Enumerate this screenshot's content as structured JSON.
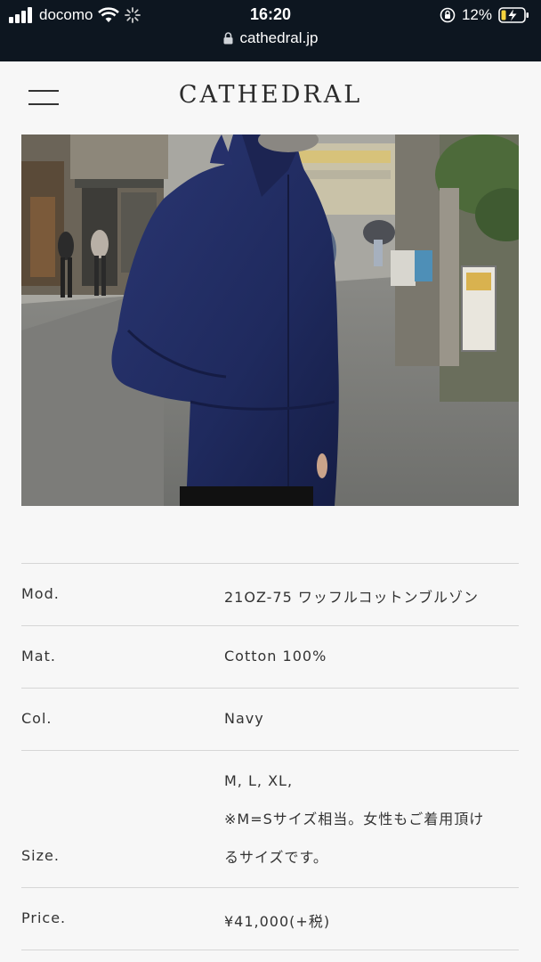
{
  "status_bar": {
    "carrier": "docomo",
    "time": "16:20",
    "battery": "12%",
    "url": "cathedral.jp"
  },
  "header": {
    "logo": "CATHEDRAL"
  },
  "specs": {
    "mod_label": "Mod.",
    "mod_value": "21OZ-75 ワッフルコットンブルゾン",
    "mat_label": "Mat.",
    "mat_value": "Cotton 100%",
    "col_label": "Col.",
    "col_value": "Navy",
    "size_label": "Size.",
    "size_line1": "M, L, XL,",
    "size_line2": "※M=Sサイズ相当。女性もご着用頂け",
    "size_line3": "るサイズです。",
    "price_label": "Price.",
    "price_value": "¥41,000(+税)"
  }
}
